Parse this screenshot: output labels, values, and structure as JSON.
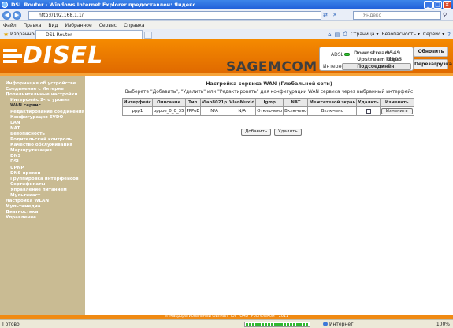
{
  "window": {
    "title": "DSL Router - Windows Internet Explorer предоставлен: Яндекс",
    "buttons": [
      "_",
      "□",
      "✕"
    ]
  },
  "address": {
    "url": "http://192.168.1.1/",
    "search_placeholder": "Яндекс"
  },
  "menu": [
    "Файл",
    "Правка",
    "Вид",
    "Избранное",
    "Сервис",
    "Справка"
  ],
  "favorites": {
    "label": "Избранное",
    "tab_title": "DSL Router",
    "commands": [
      "Страница ▾",
      "Безопасность ▾",
      "Сервис ▾"
    ]
  },
  "header": {
    "logo": "DISEL",
    "brand": "SAGEMCOM",
    "adsl_label": "ADSL",
    "internet_label": "Интернет",
    "downstream_label": "Downstream",
    "downstream_value": "9549 kbps",
    "upstream_label": "Upstream",
    "upstream_value": "1105 kbps",
    "connect_label": "Подсоединён.",
    "refresh_label": "Обновить",
    "reboot_label": "Перезагрузка"
  },
  "sidebar": [
    {
      "label": "Информация об устройстве",
      "level": 0
    },
    {
      "label": "Соединение с Интернет",
      "level": 0
    },
    {
      "label": "Дополнительные настройки",
      "level": 0
    },
    {
      "label": "Интерфейс 2-го уровня",
      "level": 1
    },
    {
      "label": "WAN сервис",
      "level": 1,
      "active": true
    },
    {
      "label": "Редактирование соединения",
      "level": 1
    },
    {
      "label": "Конфигурация EVDO",
      "level": 1
    },
    {
      "label": "LAN",
      "level": 1
    },
    {
      "label": "NAT",
      "level": 1
    },
    {
      "label": "Безопасность",
      "level": 1
    },
    {
      "label": "Родительский контроль",
      "level": 1
    },
    {
      "label": "Качество обслуживания",
      "level": 1
    },
    {
      "label": "Маршрутизация",
      "level": 1
    },
    {
      "label": "DNS",
      "level": 1
    },
    {
      "label": "DSL",
      "level": 1
    },
    {
      "label": "UPNP",
      "level": 1
    },
    {
      "label": "DNS-прокси",
      "level": 1
    },
    {
      "label": "Группировка интерфейсов",
      "level": 1
    },
    {
      "label": "Сертификаты",
      "level": 1
    },
    {
      "label": "Управление питанием",
      "level": 1
    },
    {
      "label": "Мультикаст",
      "level": 1
    },
    {
      "label": "Настройка WLAN",
      "level": 0
    },
    {
      "label": "Мультимедиа",
      "level": 0
    },
    {
      "label": "Диагностика",
      "level": 0
    },
    {
      "label": "Управление",
      "level": 0
    }
  ],
  "main": {
    "title": "Настройка сервиса WAN (Глобальной сети)",
    "description": "Выберете \"Добавить\", \"Удалить\" или \"Редактировать\" для конфигурации WAN сервиса через выбранный интерфейс",
    "columns": [
      "Интерфейс",
      "Описание",
      "Тип",
      "Vlan8021p",
      "VlanMuxId",
      "Igmp",
      "NAT",
      "Межсетевой экран",
      "Удалить",
      "Изменить"
    ],
    "rows": [
      {
        "interface": "ppp1",
        "description": "pppoe_0_0_35",
        "type": "PPPoE",
        "vlan8021p": "N/A",
        "vlanmuxid": "N/A",
        "igmp": "Отключено",
        "nat": "Включено",
        "firewall": "Включено",
        "edit_label": "Изменить"
      }
    ],
    "add_label": "Добавить",
    "delete_label": "Удалить"
  },
  "footer": "© Макрорегиональный филиал \"ЮГ\" ОАО \"Ростелеком\", 2011",
  "statusbar": {
    "status": "Готово",
    "zone": "Интернет",
    "zoom": "100%"
  }
}
